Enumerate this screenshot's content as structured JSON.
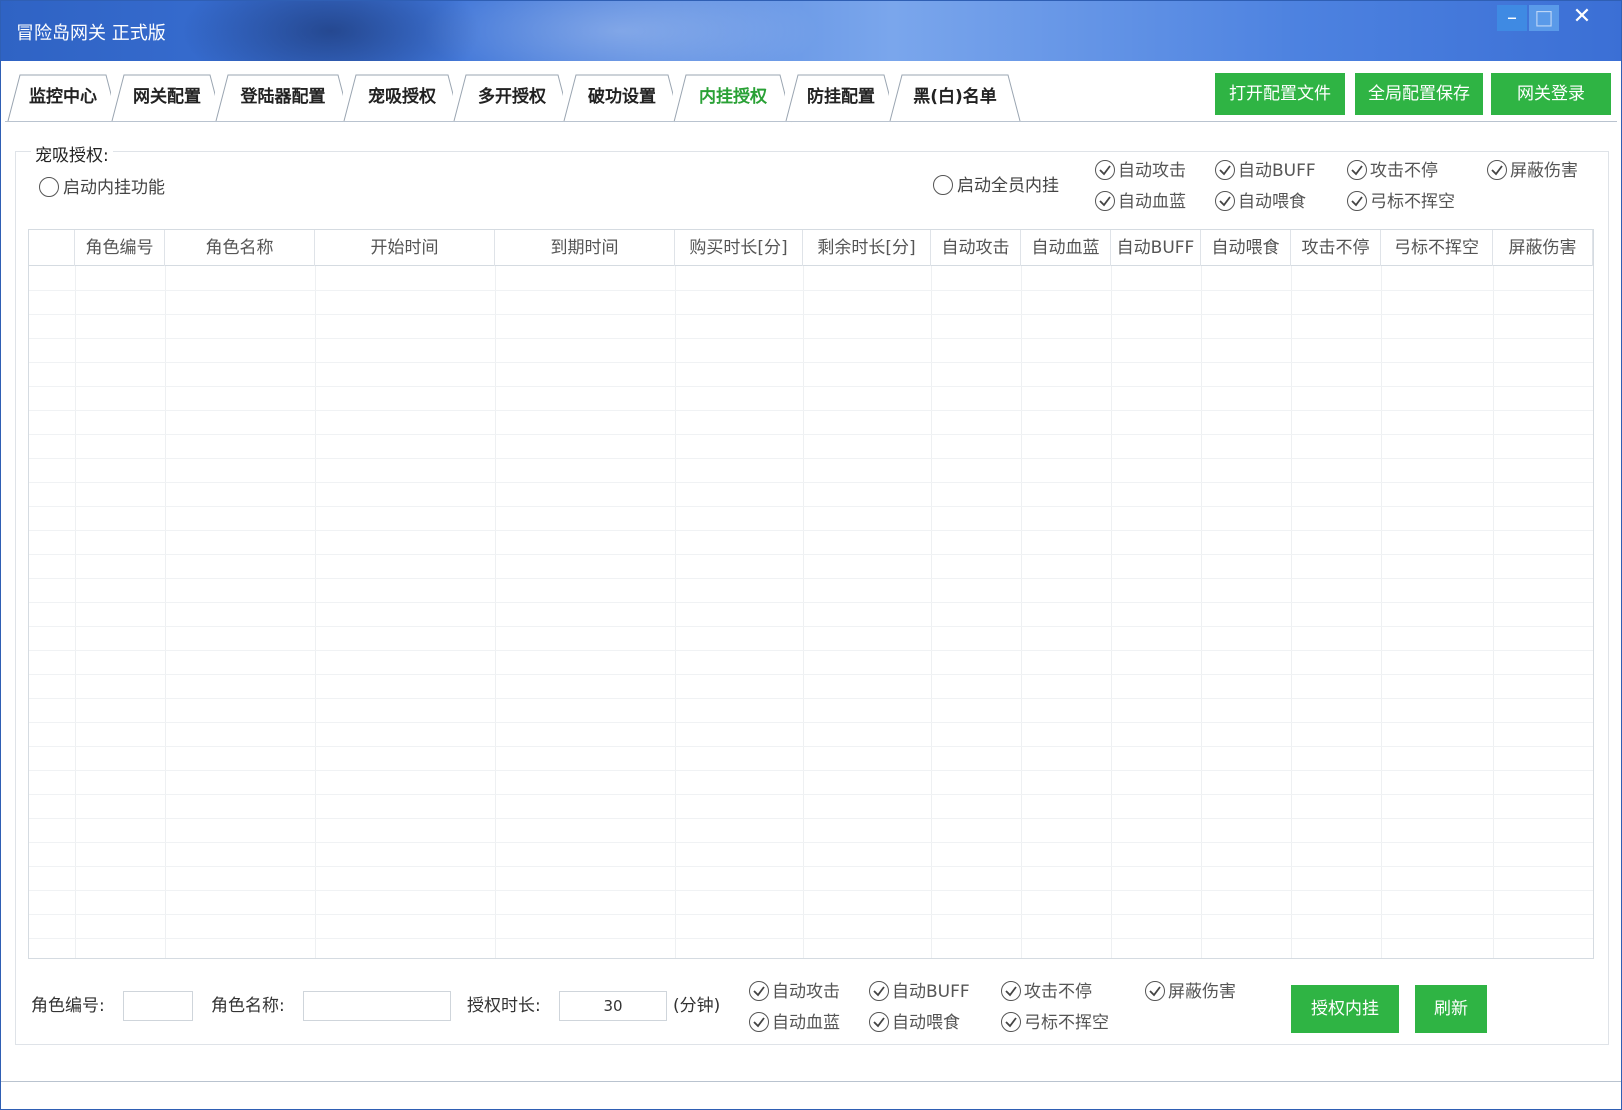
{
  "window": {
    "title": "冒险岛网关 正式版",
    "controls": {
      "minimize": "–",
      "maximize": "□",
      "close": "✕"
    }
  },
  "tabs": [
    {
      "label": "监控中心"
    },
    {
      "label": "网关配置"
    },
    {
      "label": "登陆器配置"
    },
    {
      "label": "宠吸授权"
    },
    {
      "label": "多开授权"
    },
    {
      "label": "破功设置"
    },
    {
      "label": "内挂授权",
      "active": true
    },
    {
      "label": "防挂配置"
    },
    {
      "label": "黑(白)名单"
    }
  ],
  "top_buttons": {
    "open_config": "打开配置文件",
    "save_global": "全局配置保存",
    "gateway_login": "网关登录"
  },
  "group": {
    "title": "宠吸授权:",
    "enable_radio": "启动内挂功能",
    "all_members_radio": "启动全员内挂",
    "top_checks": [
      {
        "label": "自动攻击"
      },
      {
        "label": "自动BUFF"
      },
      {
        "label": "攻击不停"
      },
      {
        "label": "屏蔽伤害"
      },
      {
        "label": "自动血蓝"
      },
      {
        "label": "自动喂食"
      },
      {
        "label": "弓标不挥空"
      }
    ]
  },
  "table": {
    "columns": [
      "",
      "角色编号",
      "角色名称",
      "开始时间",
      "到期时间",
      "购买时长[分]",
      "剩余时长[分]",
      "自动攻击",
      "自动血蓝",
      "自动BUFF",
      "自动喂食",
      "攻击不停",
      "弓标不挥空",
      "屏蔽伤害"
    ],
    "rows": []
  },
  "form": {
    "role_id_label": "角色编号:",
    "role_id_value": "",
    "role_name_label": "角色名称:",
    "role_name_value": "",
    "duration_label": "授权时长:",
    "duration_value": "30",
    "duration_unit": "(分钟)",
    "checks": [
      {
        "label": "自动攻击"
      },
      {
        "label": "自动BUFF"
      },
      {
        "label": "攻击不停"
      },
      {
        "label": "屏蔽伤害"
      },
      {
        "label": "自动血蓝"
      },
      {
        "label": "自动喂食"
      },
      {
        "label": "弓标不挥空"
      }
    ],
    "authorize_button": "授权内挂",
    "refresh_button": "刷新"
  },
  "colors": {
    "accent_green": "#2fb444",
    "active_tab_text": "#2aa136",
    "titlebar_blue": "#3c72d6"
  }
}
